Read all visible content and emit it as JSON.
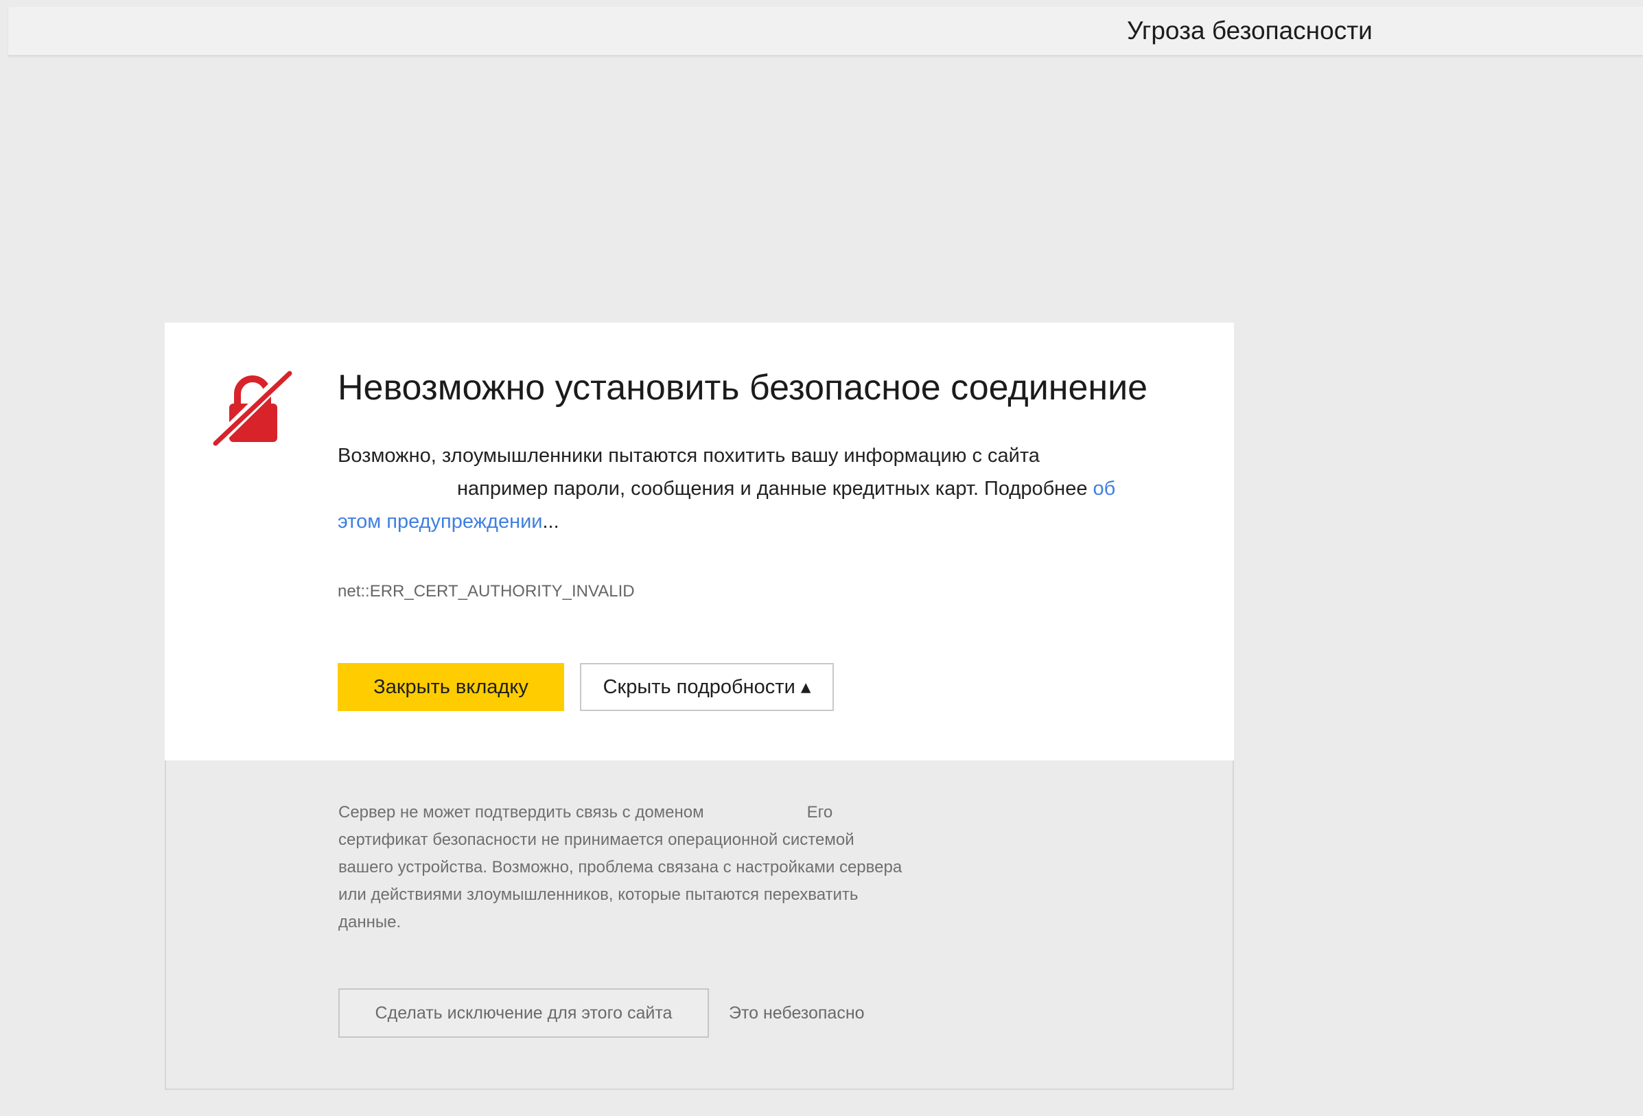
{
  "header": {
    "title": "Угроза безопасности"
  },
  "card": {
    "icon": "broken-lock-icon",
    "title": "Невозможно установить безопасное соединение",
    "description": {
      "line1": "Возможно, злоумышленники пытаются похитить вашу информацию с сайта",
      "line2": "например пароли, сообщения и данные кредитных карт. Подробнее",
      "link_part1": "об",
      "link_part2": "этом предупреждении",
      "link_suffix": "..."
    },
    "error_code": "net::ERR_CERT_AUTHORITY_INVALID",
    "close_button": "Закрыть вкладку",
    "details_button": "Скрыть подробности ▴"
  },
  "details": {
    "line1_part1": "Сервер не может подтвердить связь с доменом",
    "line1_part2": "Его",
    "line2": "сертификат безопасности не принимается операционной системой",
    "line3": "вашего устройства. Возможно, проблема связана с настройками сервера",
    "line4": "или действиями злоумышленников, которые пытаются перехватить",
    "line5": "данные.",
    "exception_button": "Сделать исключение для этого сайта",
    "unsafe_note": "Это небезопасно"
  },
  "colors": {
    "accent_button": "#ffcc00",
    "link": "#3f7fe0",
    "icon_red": "#d8232a"
  }
}
